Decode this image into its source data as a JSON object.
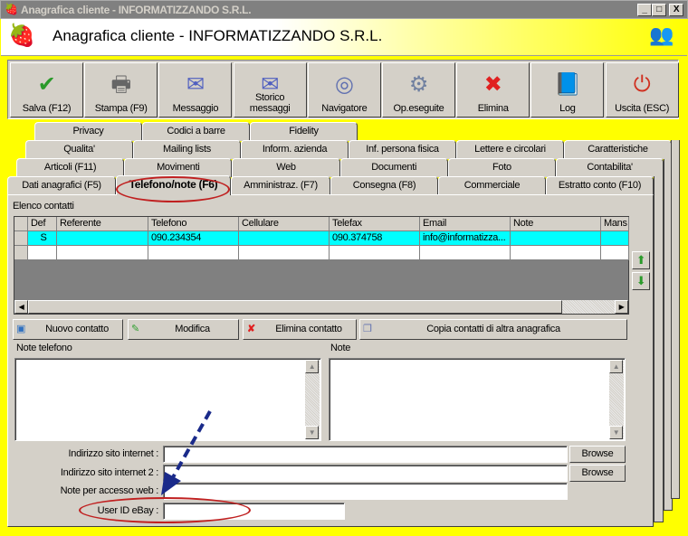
{
  "window": {
    "title": "Anagrafica cliente - INFORMATIZZANDO S.R.L.",
    "minimize": "_",
    "maximize": "□",
    "close": "X"
  },
  "header": {
    "title": "Anagrafica cliente - INFORMATIZZANDO S.R.L."
  },
  "toolbar": [
    {
      "label": "Salva (F12)",
      "icon": "check-icon",
      "glyph": "✔",
      "color": "#2a9a2a"
    },
    {
      "label": "Stampa (F9)",
      "icon": "printer-icon",
      "glyph": "🖶",
      "color": "#666666"
    },
    {
      "label": "Messaggio",
      "icon": "envelope-pen-icon",
      "glyph": "✉",
      "color": "#5060c0"
    },
    {
      "label": "Storico messaggi",
      "icon": "envelope-search-icon",
      "glyph": "✉",
      "color": "#5060c0"
    },
    {
      "label": "Navigatore",
      "icon": "compass-icon",
      "glyph": "◎",
      "color": "#6070b0"
    },
    {
      "label": "Op.eseguite",
      "icon": "gears-search-icon",
      "glyph": "⚙",
      "color": "#7080a0"
    },
    {
      "label": "Elimina",
      "icon": "x-icon",
      "glyph": "✖",
      "color": "#e02020"
    },
    {
      "label": "Log",
      "icon": "book-search-icon",
      "glyph": "📘",
      "color": "#2050c0"
    },
    {
      "label": "Uscita (ESC)",
      "icon": "power-icon",
      "glyph": "⏻",
      "color": "#d03020"
    }
  ],
  "tabs": {
    "row1": [
      "Privacy",
      "Codici a barre",
      "Fidelity"
    ],
    "row2": [
      "Qualita'",
      "Mailing lists",
      "Inform. azienda",
      "Inf. persona fisica",
      "Lettere e circolari",
      "Caratteristiche"
    ],
    "row3": [
      "Articoli (F11)",
      "Movimenti",
      "Web",
      "Documenti",
      "Foto",
      "Contabilita'"
    ],
    "row4": [
      "Dati anagrafici (F5)",
      "Telefono/note (F6)",
      "Amministraz. (F7)",
      "Consegna (F8)",
      "Commerciale",
      "Estratto conto (F10)"
    ],
    "active": "Telefono/note (F6)"
  },
  "contacts": {
    "label": "Elenco contatti",
    "columns": [
      "Def",
      "Referente",
      "Telefono",
      "Cellulare",
      "Telefax",
      "Email",
      "Note",
      "Mans"
    ],
    "rows": [
      [
        "S",
        "",
        "090.234354",
        "",
        "090.374758",
        "info@informatizza...",
        "",
        ""
      ]
    ]
  },
  "buttons": {
    "new": "Nuovo contatto",
    "edit": "Modifica",
    "delete": "Elimina contatto",
    "copy": "Copia contatti di altra anagrafica"
  },
  "notes": {
    "phone_label": "Note telefono",
    "notes_label": "Note",
    "phone_value": "",
    "notes_value": ""
  },
  "fields": [
    {
      "label": "Indirizzo sito internet :",
      "value": "",
      "browse": "Browse"
    },
    {
      "label": "Indirizzo sito internet 2 :",
      "value": "",
      "browse": "Browse"
    },
    {
      "label": "Note per accesso web :",
      "value": ""
    },
    {
      "label": "User ID eBay :",
      "value": ""
    }
  ]
}
